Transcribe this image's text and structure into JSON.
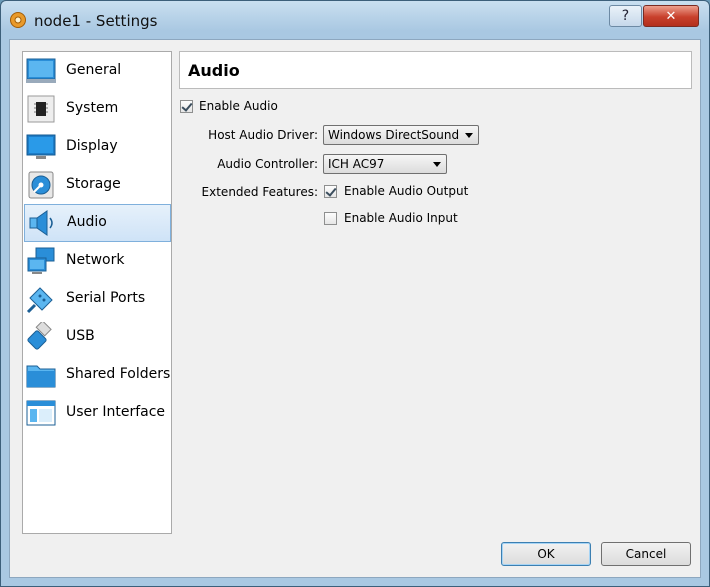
{
  "window": {
    "title": "node1 - Settings",
    "help_glyph": "?",
    "close_glyph": "✕"
  },
  "sidebar": {
    "items": [
      {
        "label": "General",
        "icon": "general-icon"
      },
      {
        "label": "System",
        "icon": "system-icon"
      },
      {
        "label": "Display",
        "icon": "display-icon"
      },
      {
        "label": "Storage",
        "icon": "storage-icon"
      },
      {
        "label": "Audio",
        "icon": "audio-icon",
        "selected": true
      },
      {
        "label": "Network",
        "icon": "network-icon"
      },
      {
        "label": "Serial Ports",
        "icon": "serial-ports-icon"
      },
      {
        "label": "USB",
        "icon": "usb-icon"
      },
      {
        "label": "Shared Folders",
        "icon": "shared-folders-icon"
      },
      {
        "label": "User Interface",
        "icon": "user-interface-icon"
      }
    ]
  },
  "page": {
    "title": "Audio",
    "enable_audio": {
      "label": "Enable Audio",
      "checked": true
    },
    "host_driver": {
      "label": "Host Audio Driver:",
      "value": "Windows DirectSound"
    },
    "controller": {
      "label": "Audio Controller:",
      "value": "ICH AC97"
    },
    "extended": {
      "label": "Extended Features:",
      "output": {
        "label": "Enable Audio Output",
        "checked": true
      },
      "input": {
        "label": "Enable Audio Input",
        "checked": false
      }
    }
  },
  "buttons": {
    "ok": "OK",
    "cancel": "Cancel"
  },
  "colors": {
    "accent": "#2a8ed8",
    "selection": "#cfe3f7",
    "close": "#c8402c"
  }
}
